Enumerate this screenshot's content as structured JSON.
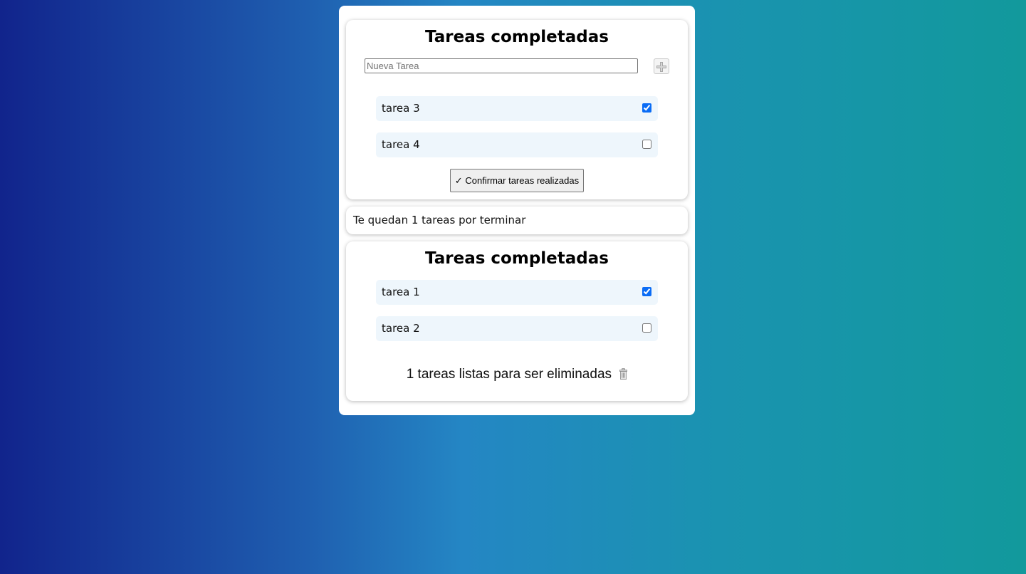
{
  "pending_card": {
    "title": "Tareas completadas",
    "new_task_placeholder": "Nueva Tarea",
    "new_task_value": "",
    "add_icon": "plus-icon",
    "tasks": [
      {
        "label": "tarea 3",
        "checked": true
      },
      {
        "label": "tarea 4",
        "checked": false
      }
    ],
    "confirm_label": "✓ Confirmar tareas realizadas"
  },
  "counter": {
    "text": "Te quedan 1 tareas por terminar"
  },
  "done_card": {
    "title": "Tareas completadas",
    "tasks": [
      {
        "label": "tarea 1",
        "checked": true
      },
      {
        "label": "tarea 2",
        "checked": false
      }
    ],
    "delete_text": "1 tareas listas para ser eliminadas",
    "delete_icon": "trash-icon"
  },
  "colors": {
    "gradient_left": "#11248c",
    "gradient_mid": "#2486c4",
    "gradient_right": "#12999c",
    "task_row_bg": "#eef6fc",
    "checkbox_accent": "#0a6cf5"
  }
}
